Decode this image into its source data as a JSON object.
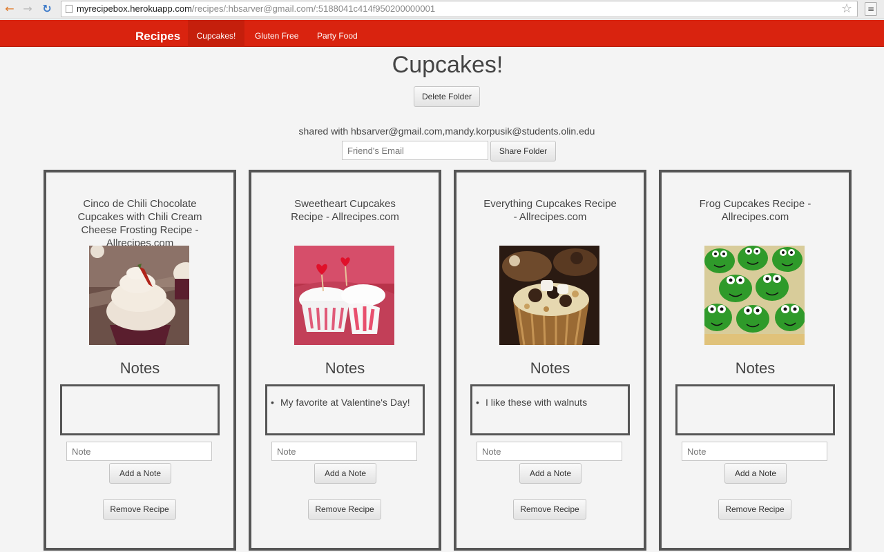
{
  "browser": {
    "url_host": "myrecipebox.herokuapp.com",
    "url_path": "/recipes/:hbsarver@gmail.com/:5188041c414f950200000001"
  },
  "navbar": {
    "brand": "Recipes",
    "items": [
      {
        "label": "Cupcakes!",
        "active": true
      },
      {
        "label": "Gluten Free",
        "active": false
      },
      {
        "label": "Party Food",
        "active": false
      }
    ]
  },
  "folder": {
    "title": "Cupcakes!",
    "delete_label": "Delete Folder",
    "shared_with": "shared with hbsarver@gmail.com,mandy.korpusik@students.olin.edu",
    "email_placeholder": "Friend's Email",
    "share_label": "Share Folder"
  },
  "recipes": [
    {
      "title": "Cinco de Chili Chocolate Cupcakes with Chili Cream Cheese Frosting Recipe - Allrecipes.com",
      "notes_heading": "Notes",
      "notes": [],
      "note_placeholder": "Note",
      "add_label": "Add a Note",
      "remove_label": "Remove Recipe"
    },
    {
      "title": "Sweetheart Cupcakes Recipe - Allrecipes.com",
      "notes_heading": "Notes",
      "notes": [
        "My favorite at Valentine's Day!"
      ],
      "note_placeholder": "Note",
      "add_label": "Add a Note",
      "remove_label": "Remove Recipe"
    },
    {
      "title": "Everything Cupcakes Recipe - Allrecipes.com",
      "notes_heading": "Notes",
      "notes": [
        "I like these with walnuts"
      ],
      "note_placeholder": "Note",
      "add_label": "Add a Note",
      "remove_label": "Remove Recipe"
    },
    {
      "title": "Frog Cupcakes Recipe - Allrecipes.com",
      "notes_heading": "Notes",
      "notes": [],
      "note_placeholder": "Note",
      "add_label": "Add a Note",
      "remove_label": "Remove Recipe"
    }
  ],
  "colors": {
    "navbar": "#d9230f",
    "card_border": "#555555",
    "background": "#f4f4f4"
  }
}
